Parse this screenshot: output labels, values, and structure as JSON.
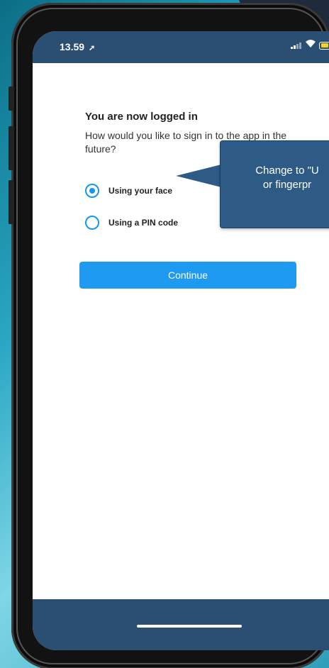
{
  "status_bar": {
    "time": "13.59",
    "location_icon": "location-arrow-icon",
    "signal_icon": "signal-icon",
    "wifi_icon": "wifi-icon",
    "battery_icon": "battery-icon",
    "battery_color": "#f7d514"
  },
  "login": {
    "title": "You are now logged in",
    "question": "How would you like to sign in to the app in the future?",
    "options": [
      {
        "label": "Using your face",
        "selected": true
      },
      {
        "label": "Using a PIN code",
        "selected": false
      }
    ],
    "continue_label": "Continue"
  },
  "callout": {
    "text": "Change to \"U\nor fingerpr"
  },
  "colors": {
    "accent": "#1e9af1",
    "bar": "#2b4e73",
    "callout": "#2e5b86"
  }
}
